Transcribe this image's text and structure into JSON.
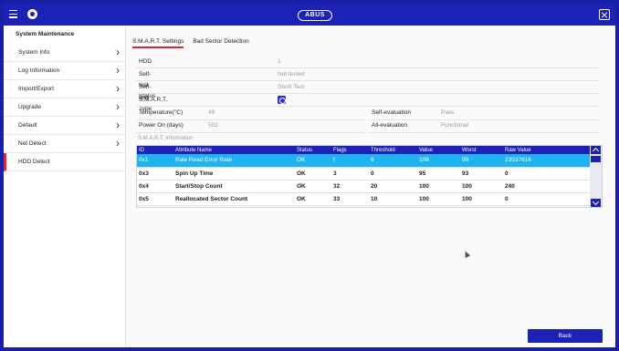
{
  "topbar": {
    "logo": "ABUS",
    "accent": "#1d22b6"
  },
  "sidebar": {
    "title": "System Maintenance",
    "items": [
      {
        "label": "System Info"
      },
      {
        "label": "Log Information"
      },
      {
        "label": "Import/Export"
      },
      {
        "label": "Upgrade"
      },
      {
        "label": "Default"
      },
      {
        "label": "Net Detect"
      },
      {
        "label": "HDD Detect"
      }
    ]
  },
  "tabs": [
    {
      "label": "S.M.A.R.T. Settings"
    },
    {
      "label": "Bad Sector Detection"
    }
  ],
  "fields": {
    "hdd": {
      "label": "HDD",
      "value": "1"
    },
    "self_test_status": {
      "label": "Self-test Status",
      "value": "Not tested"
    },
    "self_test_type": {
      "label": "Self-test Type",
      "value": "Short Test"
    },
    "smart": {
      "label": "S.M.A.R.T."
    },
    "temperature": {
      "label": "Temperature(°C)",
      "value": "49"
    },
    "power_on": {
      "label": "Power On (days)",
      "value": "502"
    },
    "self_evaluation": {
      "label": "Self-evaluation",
      "value": "Pass"
    },
    "all_evaluation": {
      "label": "All-evaluation",
      "value": "Functional"
    }
  },
  "smart_info": {
    "title": "S.M.A.R.T. Information",
    "columns": [
      "ID",
      "Attribute Name",
      "Status",
      "Flags",
      "Threshold",
      "Value",
      "Worst",
      "Raw Value"
    ],
    "rows": [
      [
        "0x1",
        "Raw Read Error Rate",
        "OK",
        "f",
        "6",
        "108",
        "99",
        "23537616"
      ],
      [
        "0x3",
        "Spin Up Time",
        "OK",
        "3",
        "0",
        "95",
        "93",
        "0"
      ],
      [
        "0x4",
        "Start/Stop Count",
        "OK",
        "32",
        "20",
        "100",
        "100",
        "240"
      ],
      [
        "0x5",
        "Reallocated Sector Count",
        "OK",
        "33",
        "10",
        "100",
        "100",
        "0"
      ]
    ]
  },
  "footer": {
    "back_label": "Back"
  },
  "colors": {
    "active_indicator": "#e0282e",
    "selected_row": "#1fb3ef",
    "header": "#1d22b6"
  }
}
